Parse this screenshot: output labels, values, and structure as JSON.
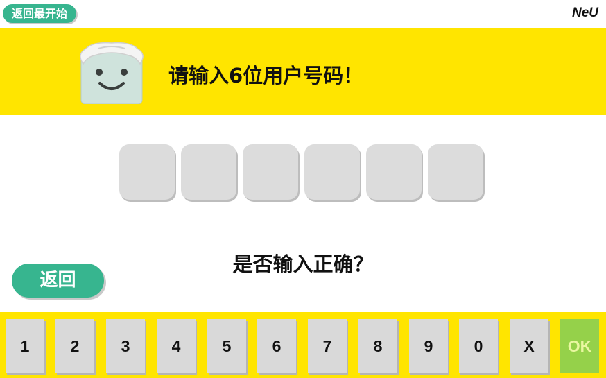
{
  "header": {
    "restart_label": "返回最开始",
    "logo_text": "NeU"
  },
  "banner": {
    "title": "请输入6位用户号码！",
    "mascot_icon": "robot-mascot-icon"
  },
  "code_entry": {
    "digits": [
      "",
      "",
      "",
      "",
      "",
      ""
    ]
  },
  "question": "是否输入正确？",
  "back_label": "返回",
  "keypad": {
    "keys": [
      "1",
      "2",
      "3",
      "4",
      "5",
      "6",
      "7",
      "8",
      "9",
      "0",
      "X",
      "OK"
    ]
  },
  "colors": {
    "accent_green": "#37b58f",
    "banner_yellow": "#ffe500",
    "ok_green": "#95d14a",
    "key_gray": "#d9d9d9"
  }
}
